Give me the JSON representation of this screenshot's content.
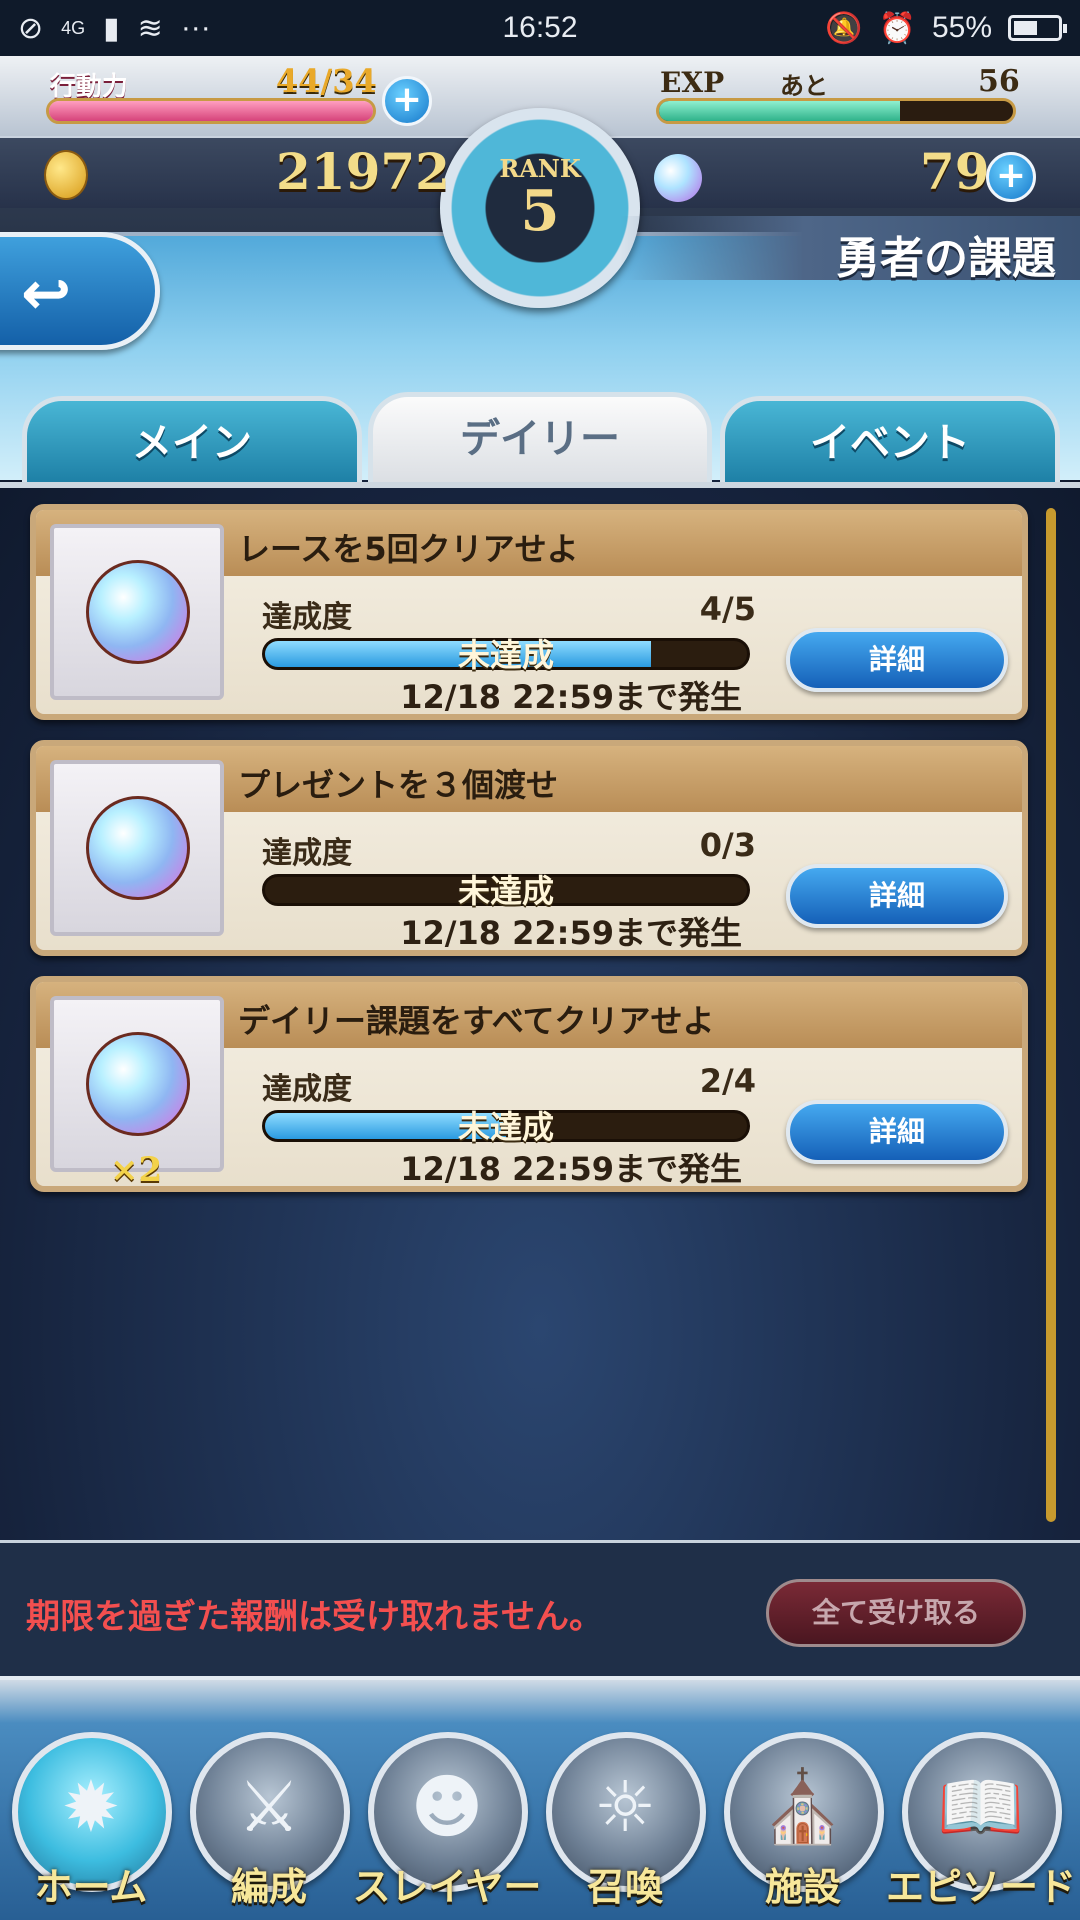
{
  "status_bar": {
    "network": "4G",
    "time": "16:52",
    "battery": "55%"
  },
  "header": {
    "stamina_label": "行動力",
    "stamina_value": "44/34",
    "exp_label": "EXP",
    "exp_remaining_label": "あと",
    "exp_remaining": "56",
    "rank_label": "RANK",
    "rank_value": "5",
    "coins": "21972",
    "orbs": "79",
    "page_title": "勇者の課題",
    "stamina_fill": 1.0,
    "exp_fill": 0.68
  },
  "tabs": [
    {
      "label": "メイン",
      "active": false
    },
    {
      "label": "デイリー",
      "active": true
    },
    {
      "label": "イベント",
      "active": false
    }
  ],
  "missions": [
    {
      "title": "レースを5回クリアせよ",
      "progress_label": "達成度",
      "progress": "4/5",
      "progress_fraction": 0.8,
      "status": "未達成",
      "deadline": "12/18  22:59まで発生",
      "reward_qty": "",
      "button": "詳細"
    },
    {
      "title": "プレゼントを３個渡せ",
      "progress_label": "達成度",
      "progress": "0/3",
      "progress_fraction": 0.0,
      "status": "未達成",
      "deadline": "12/18  22:59まで発生",
      "reward_qty": "",
      "button": "詳細"
    },
    {
      "title": "デイリー課題をすべてクリアせよ",
      "progress_label": "達成度",
      "progress": "2/4",
      "progress_fraction": 0.5,
      "status": "未達成",
      "deadline": "12/18  22:59まで発生",
      "reward_qty": "×2",
      "button": "詳細"
    }
  ],
  "notice": {
    "text": "期限を過ぎた報酬は受け取れません。",
    "claim_all": "全て受け取る"
  },
  "nav": [
    {
      "label": "ホーム",
      "icon": "map-icon"
    },
    {
      "label": "編成",
      "icon": "sword-icon"
    },
    {
      "label": "スレイヤー",
      "icon": "character-icon"
    },
    {
      "label": "召喚",
      "icon": "sun-icon"
    },
    {
      "label": "施設",
      "icon": "castle-icon"
    },
    {
      "label": "エピソード",
      "icon": "book-icon"
    }
  ],
  "colors": {
    "notice_text": "#f34f4f",
    "gold_text": "#f3dd8a",
    "progress_fill": "#2a9ae0"
  }
}
